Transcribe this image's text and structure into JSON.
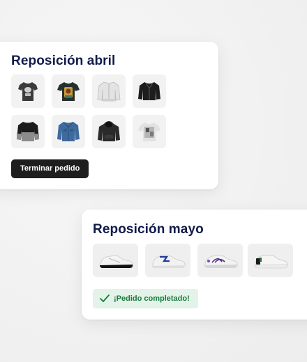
{
  "cards": {
    "april": {
      "title": "Reposición abril",
      "items": [
        {
          "name": "graphic-tshirt-dark-icon"
        },
        {
          "name": "graphic-tshirt-print-icon"
        },
        {
          "name": "white-bomber-jacket-icon"
        },
        {
          "name": "black-leather-jacket-icon"
        },
        {
          "name": "colorblock-jacket-icon"
        },
        {
          "name": "denim-jacket-icon"
        },
        {
          "name": "black-hoodie-icon"
        },
        {
          "name": "white-graphic-tshirt-icon"
        }
      ],
      "button_label": "Terminar pedido"
    },
    "may": {
      "title": "Reposición mayo",
      "items": [
        {
          "name": "white-black-sneaker-icon"
        },
        {
          "name": "white-blue-sneaker-icon"
        },
        {
          "name": "white-purple-sneaker-icon"
        },
        {
          "name": "white-green-sneaker-icon"
        }
      ],
      "badge_text": "¡Pedido completado!",
      "badge_icon": "check-icon"
    }
  },
  "colors": {
    "title": "#111b4a",
    "button_bg": "#1e1e1e",
    "badge_bg": "#e4f3ea",
    "badge_text": "#177a3a"
  }
}
